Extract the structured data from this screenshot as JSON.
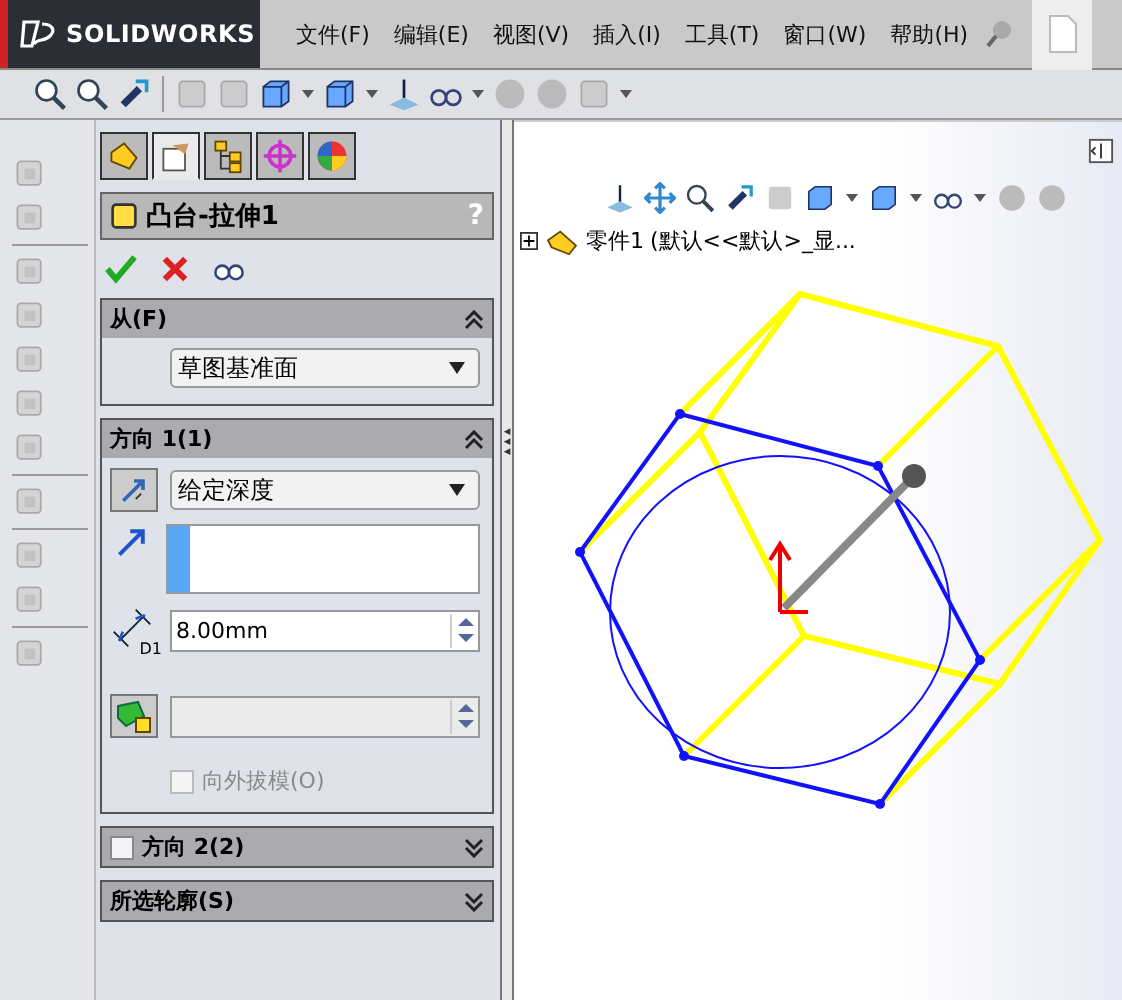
{
  "app": {
    "logo": "SOLIDWORKS"
  },
  "menu": [
    {
      "label": "文件(F)"
    },
    {
      "label": "编辑(E)"
    },
    {
      "label": "视图(V)"
    },
    {
      "label": "插入(I)"
    },
    {
      "label": "工具(T)"
    },
    {
      "label": "窗口(W)"
    },
    {
      "label": "帮助(H)"
    }
  ],
  "panel_tabs": [
    {
      "selected": false
    },
    {
      "selected": true
    },
    {
      "selected": false
    },
    {
      "selected": false
    },
    {
      "selected": false
    }
  ],
  "feature": {
    "title": "凸台-拉伸1",
    "help": "?"
  },
  "sections": [
    {
      "kind": "from",
      "title": "从(F)",
      "expanded": true,
      "dropdown": "草图基准面"
    },
    {
      "kind": "direction",
      "title": "方向 1(1)",
      "expanded": true,
      "dropdown": "给定深度",
      "depth": "8.00mm",
      "depth_tag": "D1",
      "draft_label": "向外拔模(O)",
      "draft_checked": false,
      "draft_disabled": true
    },
    {
      "kind": "collapsed_check",
      "title": "方向 2(2)",
      "expanded": false,
      "checked": false
    },
    {
      "kind": "collapsed",
      "title": "所选轮廓(S)",
      "expanded": false
    }
  ],
  "tree": {
    "label": "零件1",
    "config": "(默认<<默认>_显..."
  }
}
